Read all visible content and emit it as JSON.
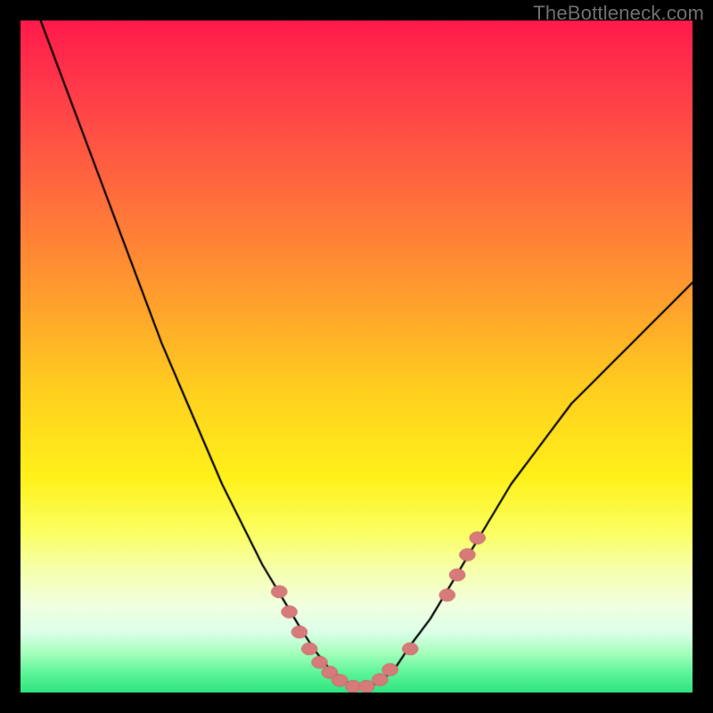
{
  "watermark": "TheBottleneck.com",
  "colors": {
    "bg": "#000000",
    "curve": "#000000",
    "marker_fill": "#d77a7a",
    "marker_stroke": "#c86b6b"
  },
  "gradient_stops": [
    {
      "pos": 0.0,
      "color": "#ff1a4b"
    },
    {
      "pos": 0.1,
      "color": "#ff3a4a"
    },
    {
      "pos": 0.25,
      "color": "#ff6a3e"
    },
    {
      "pos": 0.4,
      "color": "#ff9a2f"
    },
    {
      "pos": 0.55,
      "color": "#ffcf1f"
    },
    {
      "pos": 0.68,
      "color": "#fff11a"
    },
    {
      "pos": 0.76,
      "color": "#fbff60"
    },
    {
      "pos": 0.82,
      "color": "#f6ffb0"
    },
    {
      "pos": 0.87,
      "color": "#f1ffe0"
    },
    {
      "pos": 0.91,
      "color": "#dcffe8"
    },
    {
      "pos": 0.94,
      "color": "#a8ffbf"
    },
    {
      "pos": 0.97,
      "color": "#60f59a"
    },
    {
      "pos": 1.0,
      "color": "#2de57f"
    }
  ],
  "chart_data": {
    "type": "line",
    "title": "",
    "xlabel": "",
    "ylabel": "",
    "xlim": [
      0,
      100
    ],
    "ylim": [
      0,
      100
    ],
    "series": [
      {
        "name": "bottleneck-curve",
        "x": [
          3,
          6,
          9,
          12,
          15,
          18,
          21,
          24,
          27,
          30,
          33,
          36,
          39,
          42,
          44,
          46,
          48,
          50,
          52,
          54,
          56,
          58,
          61,
          64,
          67,
          70,
          73,
          76,
          79,
          82,
          85,
          88,
          91,
          94,
          97,
          100
        ],
        "y": [
          100,
          92,
          84,
          76,
          68,
          60,
          52,
          45,
          38,
          31,
          25,
          19,
          14,
          9,
          6,
          3.5,
          1.8,
          0.8,
          0.9,
          2.0,
          4.0,
          7,
          11,
          16,
          21,
          26,
          31,
          35,
          39,
          43,
          46,
          49,
          52,
          55,
          58,
          61
        ]
      }
    ],
    "markers": [
      {
        "x": 38.5,
        "y": 15
      },
      {
        "x": 40.0,
        "y": 12
      },
      {
        "x": 41.5,
        "y": 9
      },
      {
        "x": 43.0,
        "y": 6.5
      },
      {
        "x": 44.5,
        "y": 4.5
      },
      {
        "x": 46.0,
        "y": 3.0
      },
      {
        "x": 47.5,
        "y": 1.8
      },
      {
        "x": 49.5,
        "y": 0.9
      },
      {
        "x": 51.5,
        "y": 0.9
      },
      {
        "x": 53.5,
        "y": 1.9
      },
      {
        "x": 55.0,
        "y": 3.4
      },
      {
        "x": 58.0,
        "y": 6.5
      },
      {
        "x": 63.5,
        "y": 14.5
      },
      {
        "x": 65.0,
        "y": 17.5
      },
      {
        "x": 66.5,
        "y": 20.5
      },
      {
        "x": 68.0,
        "y": 23.0
      }
    ],
    "marker_radius": 8
  }
}
